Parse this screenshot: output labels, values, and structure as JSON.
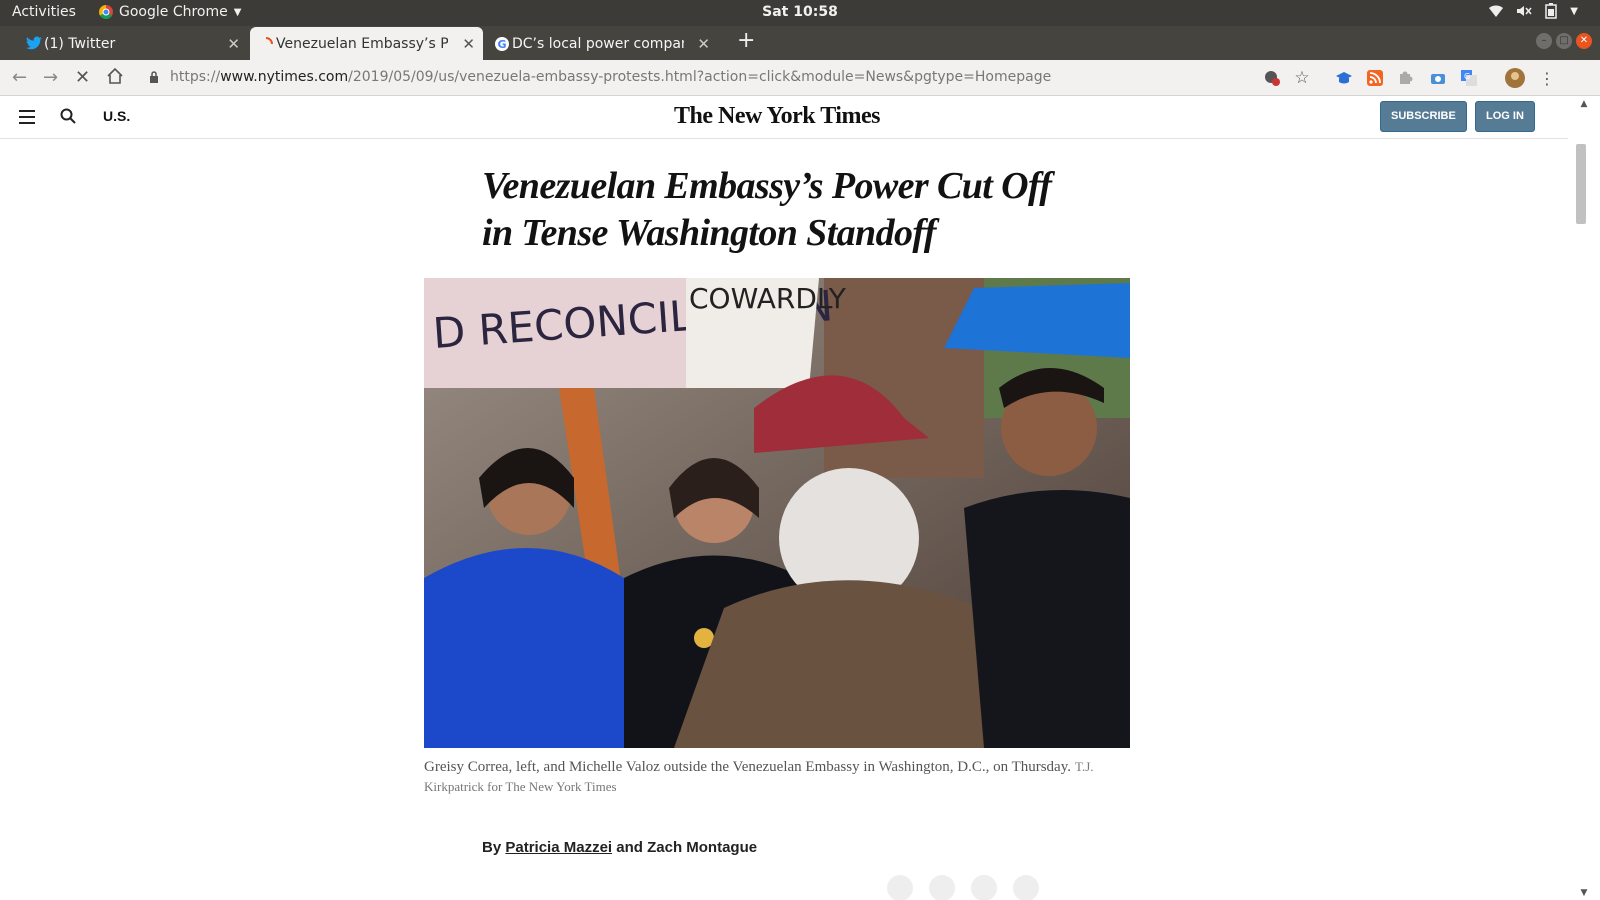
{
  "system_bar": {
    "activities_label": "Activities",
    "app_name": "Google Chrome",
    "clock": "Sat 10:58",
    "tray_icons": [
      "wifi-icon",
      "volume-muted-icon",
      "battery-icon",
      "chevron-down-icon"
    ]
  },
  "tabs": [
    {
      "label": "(1) Twitter",
      "icon": "twitter-icon",
      "active": false
    },
    {
      "label": "Venezuelan Embassy’s Po",
      "icon": "loading-icon",
      "active": true
    },
    {
      "label": "DC’s local power compan",
      "icon": "google-icon",
      "active": false
    }
  ],
  "toolbar": {
    "url_prefix": "https://",
    "url_domain": "www.nytimes.com",
    "url_path": "/2019/05/09/us/venezuela-embassy-protests.html?action=click&module=News&pgtype=Homepage",
    "extensions": [
      "adblock-icon",
      "bookmark-star-icon",
      "extension-cap-icon",
      "rss-icon",
      "extension-puzzle-icon",
      "camera-icon",
      "translate-icon",
      "profile-avatar-icon",
      "more-menu-icon"
    ]
  },
  "nyt": {
    "section": "U.S.",
    "logo": "The New York Times",
    "subscribe": "SUBSCRIBE",
    "login": "LOG IN",
    "headline_line1": "Venezuelan Embassy’s Power Cut Off",
    "headline_line2": "in Tense Washington Standoff",
    "photo_signs": {
      "sign1": "D RECONCILIATION",
      "sign2": "COWARDLY"
    },
    "caption": "Greisy Correa, left, and Michelle Valoz outside the Venezuelan Embassy in Washington, D.C., on Thursday.",
    "credit": "T.J. Kirkpatrick for The New York Times",
    "byline_prefix": "By",
    "author1": "Patricia Mazzei",
    "byline_join": "and",
    "author2": "Zach Montague"
  }
}
